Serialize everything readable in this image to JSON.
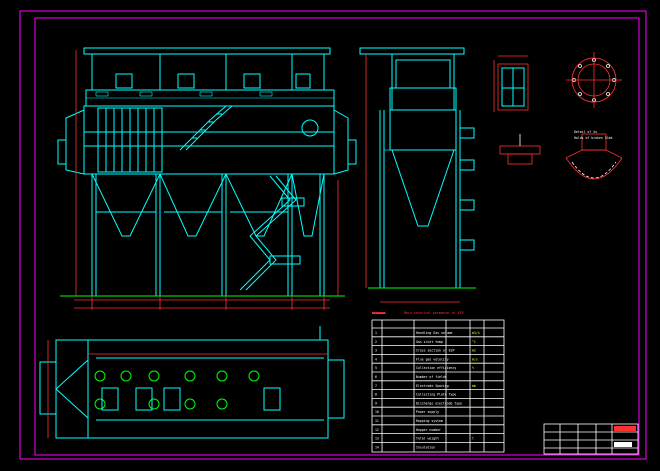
{
  "drawing": {
    "params_table_title": "Main technical parameter of ESP",
    "views": {
      "detail_title": "Detail of Xx",
      "detail_sub": "Holds of broken Slab"
    },
    "colors": {
      "background": "#000000",
      "frame": "#ff00ff",
      "structure": "#00ffff",
      "dimension": "#ff3030",
      "ground": "#00ff00",
      "table": "#ffffff"
    },
    "params_rows": [
      {
        "no": "1",
        "name": "Handling Gas volume",
        "unit": "m3/h"
      },
      {
        "no": "2",
        "name": "Gas inlet temp",
        "unit": "°C"
      },
      {
        "no": "3",
        "name": "Cross section of ESP",
        "unit": "m2"
      },
      {
        "no": "4",
        "name": "Flue gas velocity",
        "unit": "m/s"
      },
      {
        "no": "5",
        "name": "Collection efficiency",
        "unit": "%"
      },
      {
        "no": "6",
        "name": "Number of fields",
        "unit": ""
      },
      {
        "no": "7",
        "name": "Electrode Spacing",
        "unit": "mm"
      },
      {
        "no": "8",
        "name": "Collecting Plate Type",
        "unit": ""
      },
      {
        "no": "9",
        "name": "Discharge electrode type",
        "unit": ""
      },
      {
        "no": "10",
        "name": "Power supply",
        "unit": ""
      },
      {
        "no": "11",
        "name": "Rapping system",
        "unit": ""
      },
      {
        "no": "12",
        "name": "Hopper number",
        "unit": ""
      },
      {
        "no": "13",
        "name": "Total weight",
        "unit": "t"
      },
      {
        "no": "14",
        "name": "Insulation",
        "unit": ""
      }
    ]
  }
}
